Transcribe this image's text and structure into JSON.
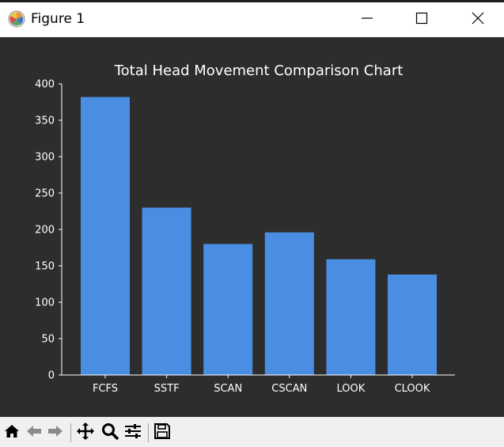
{
  "window": {
    "title": "Figure 1",
    "controls": [
      "minimize-icon",
      "maximize-icon",
      "close-icon"
    ]
  },
  "toolbar": {
    "buttons": [
      "home-icon",
      "back-arrow-icon",
      "forward-arrow-icon",
      "pan-icon",
      "zoom-icon",
      "configure-subplots-icon",
      "save-icon"
    ]
  },
  "colors": {
    "figure_bg": "#2d2d2d",
    "bar": "#4a8ee3",
    "text": "#ffffff",
    "toolbar_bg": "#f0f0f0"
  },
  "chart_data": {
    "type": "bar",
    "title": "Total Head Movement Comparison Chart",
    "xlabel": "",
    "ylabel": "",
    "categories": [
      "FCFS",
      "SSTF",
      "SCAN",
      "CSCAN",
      "LOOK",
      "CLOOK"
    ],
    "values": [
      382,
      230,
      180,
      196,
      159,
      138
    ],
    "ylim": [
      0,
      400
    ],
    "yticks": [
      "0",
      "50",
      "100",
      "150",
      "200",
      "250",
      "300",
      "350",
      "400"
    ],
    "grid": false
  }
}
